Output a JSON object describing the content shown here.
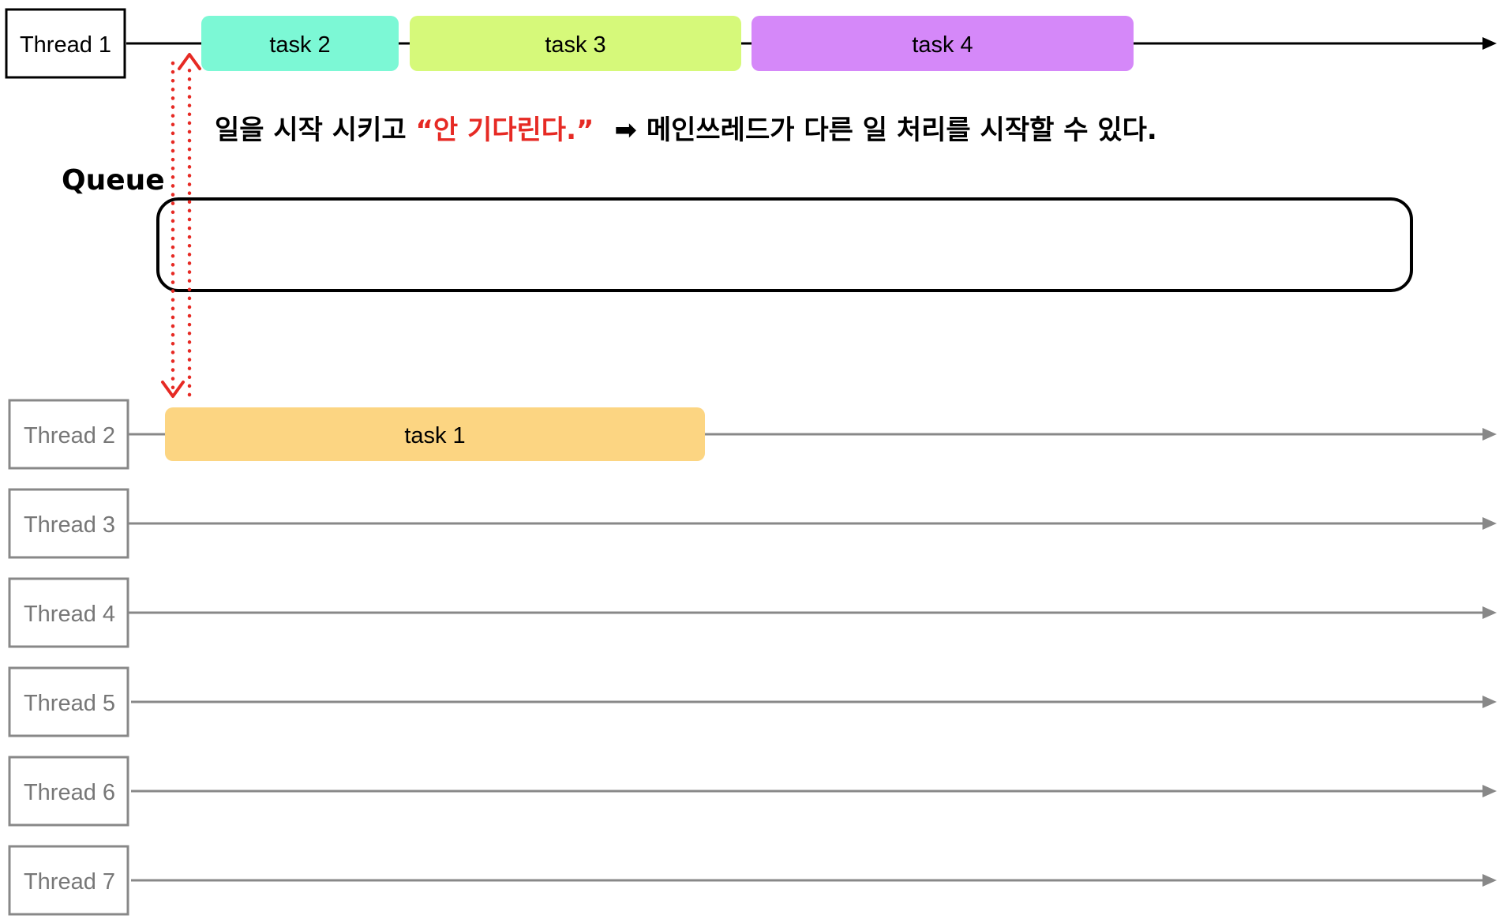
{
  "main_thread": {
    "label": "Thread 1",
    "tasks": [
      {
        "label": "task 2",
        "color": "#7cf8d5"
      },
      {
        "label": "task 3",
        "color": "#d6f97a"
      },
      {
        "label": "task 4",
        "color": "#d588f9"
      }
    ]
  },
  "annotation": {
    "prefix": "일을 시작 시키고 ",
    "highlight": "“안 기다린다.”",
    "arrow": "➡",
    "suffix": "메인쓰레드가 다른 일 처리를 시작할 수 있다.",
    "highlight_color": "#e62a24"
  },
  "queue": {
    "label": "Queue"
  },
  "worker_threads": [
    {
      "label": "Thread 2",
      "task": {
        "label": "task 1",
        "color": "#fcd582"
      }
    },
    {
      "label": "Thread 3"
    },
    {
      "label": "Thread 4"
    },
    {
      "label": "Thread 5"
    },
    {
      "label": "Thread 6"
    },
    {
      "label": "Thread 7"
    }
  ],
  "colors": {
    "main_line": "#000000",
    "worker_line": "#888888",
    "dispatch_arrow": "#e62a24"
  }
}
